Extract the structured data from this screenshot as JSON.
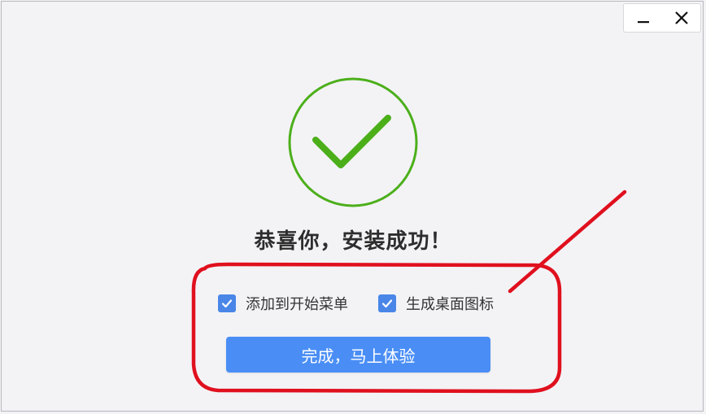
{
  "window": {
    "minimize_icon": "minimize-icon",
    "close_icon": "close-icon"
  },
  "success": {
    "icon": "check-circle-icon",
    "color": "#4caf1a",
    "headline": "恭喜你，安装成功！"
  },
  "options": [
    {
      "label": "添加到开始菜单",
      "checked": true
    },
    {
      "label": "生成桌面图标",
      "checked": true
    }
  ],
  "finish_button": {
    "label": "完成，马上体验",
    "color": "#4a8ef5"
  },
  "annotation": {
    "color": "#e0101e"
  }
}
